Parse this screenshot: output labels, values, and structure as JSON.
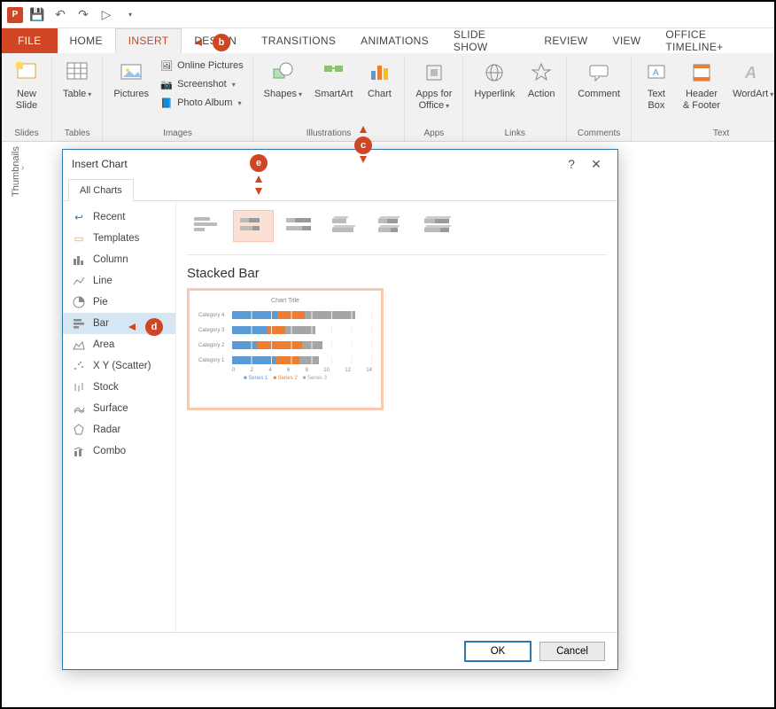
{
  "qat": {
    "save": "💾",
    "undo": "↶",
    "redo": "↷",
    "start": "▷"
  },
  "tabs": {
    "file": "FILE",
    "home": "HOME",
    "insert": "INSERT",
    "design": "DESIGN",
    "transitions": "TRANSITIONS",
    "animations": "ANIMATIONS",
    "slideshow": "SLIDE SHOW",
    "review": "REVIEW",
    "view": "VIEW",
    "timeline": "OFFICE TIMELINE+"
  },
  "groups": {
    "slides": "Slides",
    "tables": "Tables",
    "images": "Images",
    "illustrations": "Illustrations",
    "apps": "Apps",
    "links": "Links",
    "comments": "Comments",
    "text": "Text"
  },
  "btns": {
    "newslide": "New\nSlide",
    "table": "Table",
    "pictures": "Pictures",
    "online": "Online Pictures",
    "screenshot": "Screenshot",
    "album": "Photo Album",
    "shapes": "Shapes",
    "smartart": "SmartArt",
    "chart": "Chart",
    "apps": "Apps for\nOffice",
    "hyperlink": "Hyperlink",
    "action": "Action",
    "comment": "Comment",
    "textbox": "Text\nBox",
    "headerfooter": "Header\n& Footer",
    "wordart": "WordArt"
  },
  "thumbnails": "Thumbnails",
  "dialog": {
    "title": "Insert Chart",
    "tab": "All Charts",
    "side": {
      "recent": "Recent",
      "templates": "Templates",
      "column": "Column",
      "line": "Line",
      "pie": "Pie",
      "bar": "Bar",
      "area": "Area",
      "xy": "X Y (Scatter)",
      "stock": "Stock",
      "surface": "Surface",
      "radar": "Radar",
      "combo": "Combo"
    },
    "chart_name": "Stacked Bar",
    "ok": "OK",
    "cancel": "Cancel"
  },
  "annotations": {
    "b": "b",
    "c": "c",
    "d": "d",
    "e": "e"
  },
  "chart_data": {
    "type": "bar",
    "subtype": "stacked",
    "title": "Chart Title",
    "categories": [
      "Category 4",
      "Category 3",
      "Category 2",
      "Category 1"
    ],
    "series": [
      {
        "name": "Series 1",
        "values": [
          4.5,
          3.5,
          2.5,
          4.3
        ],
        "color": "#5b9bd5"
      },
      {
        "name": "Series 2",
        "values": [
          2.8,
          1.8,
          4.5,
          2.4
        ],
        "color": "#ed7d31"
      },
      {
        "name": "Series 3",
        "values": [
          5.0,
          3.0,
          2.0,
          2.0
        ],
        "color": "#a5a5a5"
      }
    ],
    "xlim": [
      0,
      14
    ],
    "xticks": [
      0,
      2,
      4,
      6,
      8,
      10,
      12,
      14
    ]
  }
}
